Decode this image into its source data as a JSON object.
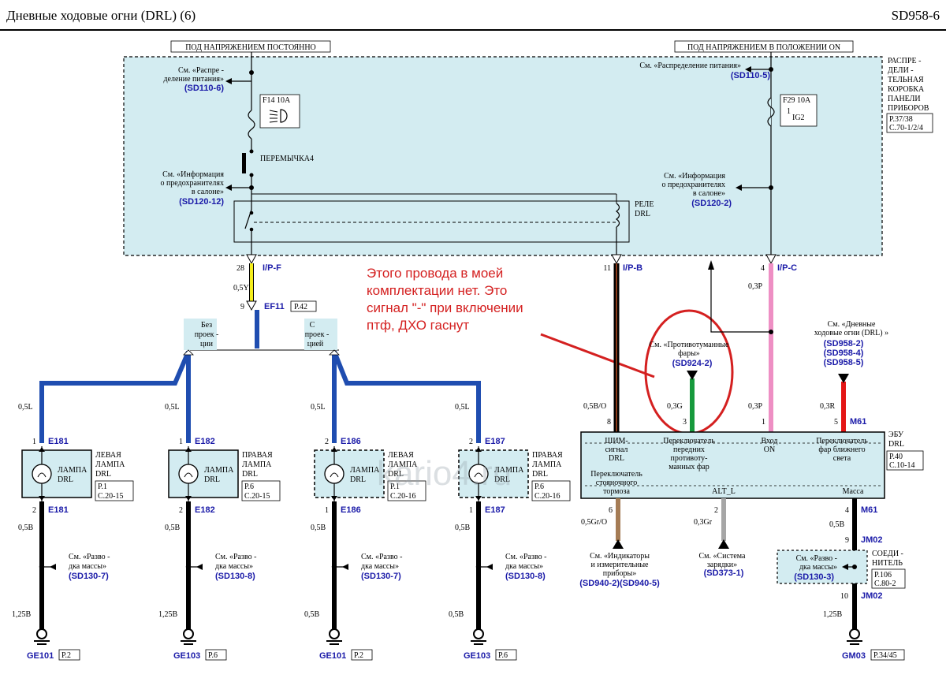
{
  "header": {
    "title": "Дневные     ходовые     огни (DRL) (6)",
    "page_code": "SD958-6"
  },
  "power_labels": {
    "constant": "ПОД НАПРЯЖЕНИЕМ ПОСТОЯННО",
    "on_position": "ПОД НАПРЯЖЕНИЕМ В ПОЛОЖЕНИИ ON"
  },
  "junction_box": {
    "title": [
      "РАСПРЕ -",
      "ДЕЛИ -",
      "ТЕЛЬНАЯ",
      "КОРОБКА",
      "ПАНЕЛИ",
      "ПРИБОРОВ"
    ],
    "ref": [
      "P.37/38",
      "C.70-1/2/4"
    ],
    "see_power_left": [
      "См. «Распре -",
      "деление   питания»"
    ],
    "see_power_left_code": "(SD110-6)",
    "see_power_right": "См. «Распределение         питания»",
    "see_power_right_code": "(SD110-5)",
    "fuse_left": "F14 10A",
    "fuse_right": "F29 10A",
    "fuse_right_label": "IG2",
    "fuse_right_pin": "1",
    "jumper": "ПЕРЕМЫЧКА4",
    "see_fuses_left": [
      "См. «Информация",
      "о предохранителях",
      "в салоне»"
    ],
    "see_fuses_left_code": "(SD120-12)",
    "see_fuses_right": [
      "См. «Информация",
      "о предохранителях",
      "в салоне»"
    ],
    "see_fuses_right_code": "(SD120-2)",
    "relay": [
      "РЕЛЕ",
      "DRL"
    ]
  },
  "connectors": {
    "ipf": "I/P-F",
    "ipf_pin": "28",
    "ipb": "I/P-B",
    "ipb_pin": "11",
    "ipc": "I/P-C",
    "ipc_pin": "4",
    "ef11": "EF11",
    "ef11_pin": "9",
    "ef11_ref": "P.42"
  },
  "wires": {
    "w05y": "0,5Y",
    "w05l": "0,5L",
    "w05b": "0,5B",
    "w125b": "1,25B",
    "w05bo": "0,5B/O",
    "w03g": "0,3G",
    "w03p": "0,3P",
    "w03r": "0,3R",
    "w05gro": "0,5Gr/O",
    "w03gr": "0,3Gr"
  },
  "annotation": [
    "Этого провода в моей",
    "комплектации нет. Это",
    "сигнал \"-\" при включении",
    "птф, ДХО гаснут"
  ],
  "options": {
    "no_proj": [
      "Без",
      "проек -",
      "ции"
    ],
    "with_proj": [
      "С",
      "проек -",
      "цией"
    ]
  },
  "lamps": [
    {
      "name": [
        "ЛЕВАЯ",
        "ЛАМПА",
        "DRL"
      ],
      "inner": [
        "ЛАМПА",
        "DRL"
      ],
      "top_conn": "E181",
      "top_pin": "1",
      "bot_conn": "E181",
      "bot_pin": "2",
      "ref": [
        "P.1",
        "C.20-15"
      ],
      "ground_code": "(SD130-7)",
      "ground": "GE101",
      "ground_ref": "P.2"
    },
    {
      "name": [
        "ПРАВАЯ",
        "ЛАМПА",
        "DRL"
      ],
      "inner": [
        "ЛАМПА",
        "DRL"
      ],
      "top_conn": "E182",
      "top_pin": "1",
      "bot_conn": "E182",
      "bot_pin": "2",
      "ref": [
        "P.6",
        "C.20-15"
      ],
      "ground_code": "(SD130-8)",
      "ground": "GE103",
      "ground_ref": "P.6"
    },
    {
      "name": [
        "ЛЕВАЯ",
        "ЛАМПА",
        "DRL"
      ],
      "inner": [
        "ЛАМПА",
        "DRL"
      ],
      "top_conn": "E186",
      "top_pin": "2",
      "bot_conn": "E186",
      "bot_pin": "1",
      "ref": [
        "P.1",
        "C.20-16"
      ],
      "ground_code": "(SD130-7)",
      "ground": "GE101",
      "ground_ref": "P.2"
    },
    {
      "name": [
        "ПРАВАЯ",
        "ЛАМПА",
        "DRL"
      ],
      "inner": [
        "ЛАМПА",
        "DRL"
      ],
      "top_conn": "E187",
      "top_pin": "2",
      "bot_conn": "E187",
      "bot_pin": "1",
      "ref": [
        "P.6",
        "C.20-16"
      ],
      "ground_code": "(SD130-8)",
      "ground": "GE103",
      "ground_ref": "P.6"
    }
  ],
  "ground_see": [
    "См. «Разво -",
    "дка  массы»"
  ],
  "ecu": {
    "title": [
      "ЭБУ",
      "DRL"
    ],
    "ref": [
      "P.40",
      "C.10-14"
    ],
    "pwm": [
      "ШИМ-",
      "сигнал",
      "DRL"
    ],
    "pwm_pin": "8",
    "fog": [
      "Переключатель",
      "передних",
      "противоту-",
      "манных  фар"
    ],
    "fog_pin": "3",
    "input_on": [
      "Вход",
      "ON"
    ],
    "input_on_pin": "1",
    "low_beam": [
      "Переключатель",
      "фар  ближнего",
      "света"
    ],
    "low_beam_pin": "5",
    "low_beam_conn": "M61",
    "parking": [
      "Переключатель",
      "стояночного",
      "тормоза"
    ],
    "parking_pin": "6",
    "alt": "ALT_L",
    "alt_pin": "2",
    "ground": "Масса",
    "ground_pin": "4",
    "ground_conn": "M61"
  },
  "ecu_refs": {
    "fog_see": [
      "См. «Противотуманные",
      "фары»"
    ],
    "fog_code": "(SD924-2)",
    "drl_see": [
      "См. «Дневные",
      "ходовые  огни (DRL) »"
    ],
    "drl_codes": [
      "(SD958-2)",
      "(SD958-4)",
      "(SD958-5)"
    ],
    "gauges_see": [
      "См. «Индикаторы",
      "и измерительные",
      "приборы»"
    ],
    "gauges_code": "(SD940-2)(SD940-5)",
    "charge_see": [
      "См. «Система",
      "зарядки»"
    ],
    "charge_code": "(SD373-1)"
  },
  "ground_right": {
    "jm02_a": "JM02",
    "jm02_a_pin": "9",
    "jm02_b": "JM02",
    "jm02_b_pin": "10",
    "see": [
      "См. «Разво -",
      "дка  массы»"
    ],
    "code": "(SD130-3)",
    "joint": [
      "СОЕДИ -",
      "НИТЕЛЬ"
    ],
    "joint_ref": [
      "P.106",
      "C.80-2"
    ],
    "gm03": "GM03",
    "gm03_ref": "P.34/45"
  },
  "watermark": "kario4.ru",
  "colors": {
    "box_fill": "#d3ecf1",
    "wire_blue": "#1f4db0",
    "wire_yellow": "#f5ee1c",
    "wire_pink": "#ee8fc4",
    "wire_green": "#179a3d",
    "wire_red": "#e41616",
    "wire_gray": "#a6a6a6",
    "wire_tan": "#a57c55",
    "annotation_red": "#d42020"
  }
}
